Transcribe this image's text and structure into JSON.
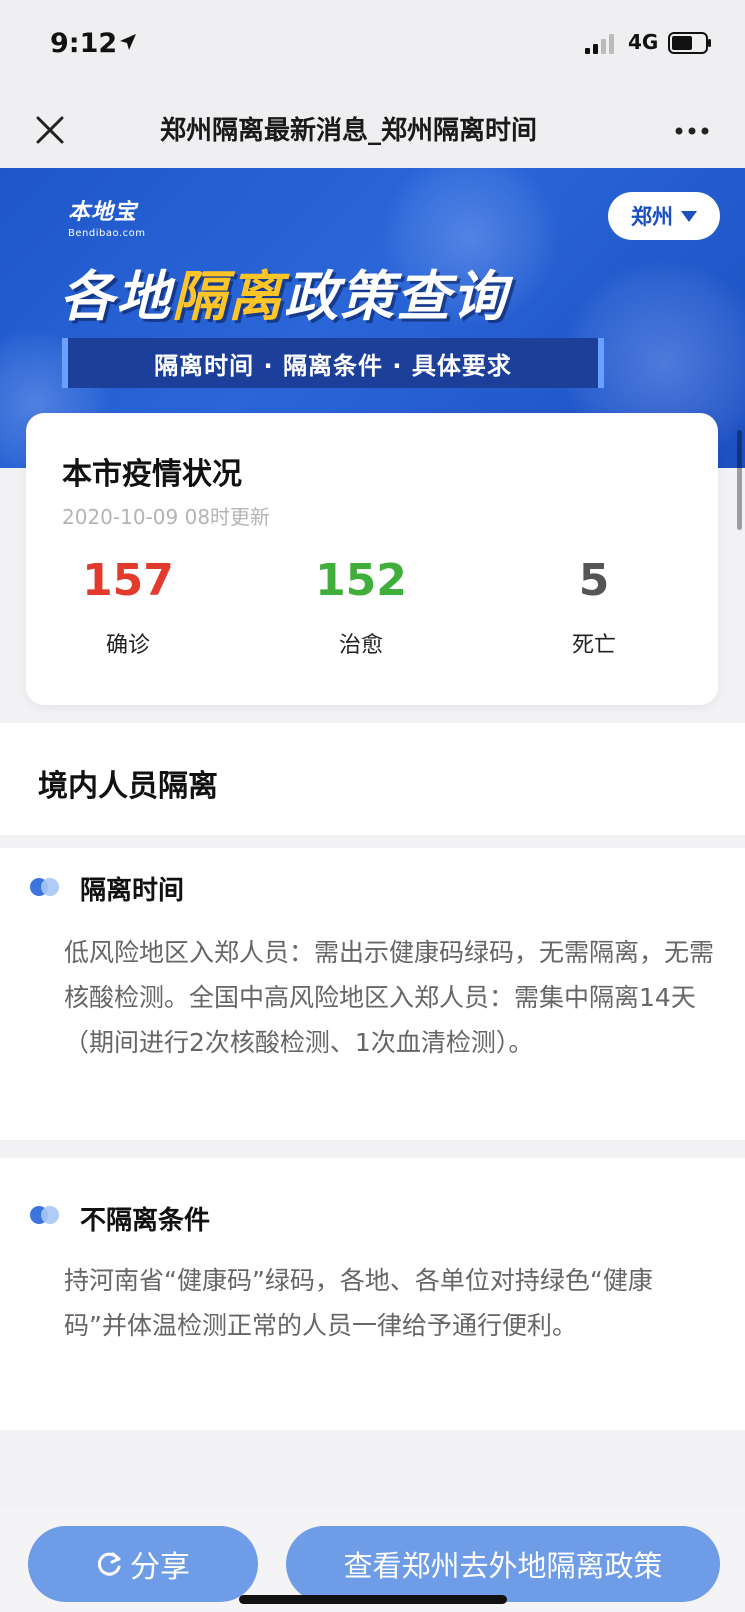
{
  "status_bar": {
    "time": "9:12",
    "network": "4G"
  },
  "nav": {
    "title": "郑州隔离最新消息_郑州隔离时间"
  },
  "banner": {
    "logo_main": "本地宝",
    "logo_sub": "Bendibao.com",
    "city": "郑州",
    "title_part1": "各地",
    "title_highlight": "隔离",
    "title_part2": "政策查询",
    "strip_text": "隔离时间 · 隔离条件 · 具体要求",
    "highlight_color": "#ffc527"
  },
  "stats": {
    "title": "本市疫情状况",
    "updated": "2020-10-09 08时更新",
    "items": [
      {
        "value": "157",
        "label": "确诊",
        "color": "#e23b2e"
      },
      {
        "value": "152",
        "label": "治愈",
        "color": "#3fae3a"
      },
      {
        "value": "5",
        "label": "死亡",
        "color": "#555555"
      }
    ]
  },
  "section": {
    "title": "境内人员隔离"
  },
  "blocks": [
    {
      "title": "隔离时间",
      "body": "低风险地区入郑人员：需出示健康码绿码，无需隔离，无需核酸检测。全国中高风险地区入郑人员：需集中隔离14天（期间进行2次核酸检测、1次血清检测）。"
    },
    {
      "title": "不隔离条件",
      "body": "持河南省“健康码”绿码，各地、各单位对持绿色“健康码”并体温检测正常的人员一律给予通行便利。"
    }
  ],
  "buttons": {
    "share": "分享",
    "policy": "查看郑州去外地隔离政策"
  },
  "colors": {
    "accent": "#3c74e0",
    "button": "#6f9ce6"
  }
}
